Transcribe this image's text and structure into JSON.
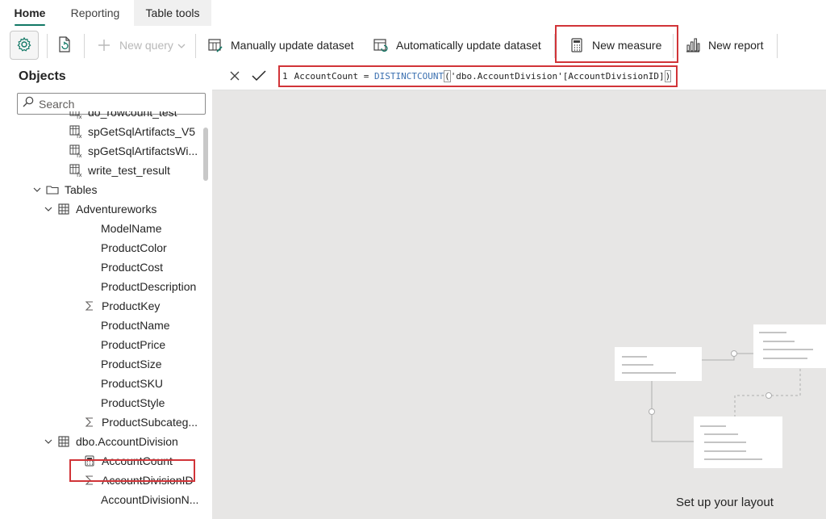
{
  "tabs": [
    {
      "label": "Home"
    },
    {
      "label": "Reporting"
    },
    {
      "label": "Table tools"
    }
  ],
  "ribbon": {
    "new_query": "New query",
    "manual_update": "Manually update dataset",
    "auto_update": "Automatically update dataset",
    "new_measure": "New measure",
    "new_report": "New report"
  },
  "left_panel": {
    "title": "Objects",
    "search_placeholder": "Search"
  },
  "tree": [
    {
      "label": "do_rowcount_test",
      "kind": "proc"
    },
    {
      "label": "spGetSqlArtifacts_V5",
      "kind": "proc"
    },
    {
      "label": "spGetSqlArtifactsWi...",
      "kind": "proc"
    },
    {
      "label": "write_test_result",
      "kind": "proc"
    },
    {
      "label": "Tables",
      "kind": "folder"
    },
    {
      "label": "Adventureworks",
      "kind": "table"
    },
    {
      "label": "ModelName",
      "kind": "column"
    },
    {
      "label": "ProductColor",
      "kind": "column"
    },
    {
      "label": "ProductCost",
      "kind": "column"
    },
    {
      "label": "ProductDescription",
      "kind": "column"
    },
    {
      "label": "ProductKey",
      "kind": "sum"
    },
    {
      "label": "ProductName",
      "kind": "column"
    },
    {
      "label": "ProductPrice",
      "kind": "column"
    },
    {
      "label": "ProductSize",
      "kind": "column"
    },
    {
      "label": "ProductSKU",
      "kind": "column"
    },
    {
      "label": "ProductStyle",
      "kind": "column"
    },
    {
      "label": "ProductSubcateg...",
      "kind": "sum"
    },
    {
      "label": "dbo.AccountDivision",
      "kind": "table"
    },
    {
      "label": "AccountCount",
      "kind": "measure"
    },
    {
      "label": "AccountDivisionID",
      "kind": "sum"
    },
    {
      "label": "AccountDivisionN...",
      "kind": "column"
    }
  ],
  "formula": {
    "line_number": "1",
    "measure_name": "AccountCount = ",
    "function": "DISTINCTCOUNT",
    "open_paren": "(",
    "table_ref": "'dbo.AccountDivision'",
    "column_ref": "[AccountDivisionID]",
    "close_paren": ")"
  },
  "canvas": {
    "setup_text": "Set up your layout"
  },
  "colors": {
    "highlight": "#d13438",
    "accent": "#117865",
    "canvas_bg": "#e7e6e5"
  }
}
